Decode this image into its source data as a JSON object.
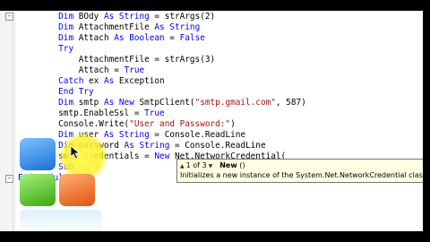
{
  "code": {
    "lines": [
      {
        "indent": "        ",
        "segs": [
          [
            "kw",
            "Dim "
          ],
          [
            "",
            "BOdy "
          ],
          [
            "kw",
            "As "
          ],
          [
            "kw",
            "String"
          ],
          [
            "",
            " = strArgs(2)"
          ]
        ]
      },
      {
        "indent": "        ",
        "segs": [
          [
            "kw",
            "Dim "
          ],
          [
            "",
            "AttachmentFile "
          ],
          [
            "kw",
            "As "
          ],
          [
            "kw",
            "String"
          ]
        ]
      },
      {
        "indent": "        ",
        "segs": [
          [
            "kw",
            "Dim "
          ],
          [
            "",
            "Attach "
          ],
          [
            "kw",
            "As "
          ],
          [
            "kw",
            "Boolean"
          ],
          [
            "",
            " = "
          ],
          [
            "kw",
            "False"
          ]
        ]
      },
      {
        "indent": "        ",
        "segs": [
          [
            "kw",
            "Try"
          ]
        ]
      },
      {
        "indent": "            ",
        "segs": [
          [
            "",
            "AttachmentFile = strArgs(3)"
          ]
        ]
      },
      {
        "indent": "            ",
        "segs": [
          [
            "",
            "Attach = "
          ],
          [
            "kw",
            "True"
          ]
        ]
      },
      {
        "indent": "        ",
        "segs": [
          [
            "kw",
            "Catch "
          ],
          [
            "",
            "ex "
          ],
          [
            "kw",
            "As "
          ],
          [
            "",
            "Exception"
          ]
        ]
      },
      {
        "indent": "        ",
        "segs": [
          [
            "kw",
            "End Try"
          ]
        ]
      },
      {
        "indent": "        ",
        "segs": [
          [
            "kw",
            "Dim "
          ],
          [
            "",
            "smtp "
          ],
          [
            "kw",
            "As New "
          ],
          [
            "",
            "SmtpClient("
          ],
          [
            "str",
            "\"smtp.gmail.com\""
          ],
          [
            "",
            ", 587)"
          ]
        ]
      },
      {
        "indent": "        ",
        "segs": [
          [
            "",
            "smtp.EnableSsl = "
          ],
          [
            "kw",
            "True"
          ]
        ]
      },
      {
        "indent": "        ",
        "segs": [
          [
            "",
            "Console.Write("
          ],
          [
            "str",
            "\"User and Password:\""
          ],
          [
            "",
            ")"
          ]
        ]
      },
      {
        "indent": "        ",
        "segs": [
          [
            "kw",
            "Dim "
          ],
          [
            "",
            "user "
          ],
          [
            "kw",
            "As "
          ],
          [
            "kw",
            "String"
          ],
          [
            "",
            " = Console.ReadLine"
          ]
        ]
      },
      {
        "indent": "        ",
        "segs": [
          [
            "kw",
            "Dim "
          ],
          [
            "",
            "password "
          ],
          [
            "kw",
            "As "
          ],
          [
            "kw",
            "String"
          ],
          [
            "",
            " = Console.ReadLine"
          ]
        ]
      },
      {
        "indent": "        ",
        "segs": [
          [
            "",
            "smtp.Credentials = "
          ],
          [
            "kw",
            "New "
          ],
          [
            "",
            "Net.NetworkCredential("
          ]
        ]
      },
      {
        "indent": "    ",
        "segs": [
          [
            "kw",
            "End Sub"
          ]
        ]
      },
      {
        "indent": "",
        "segs": [
          [
            "kw",
            "End Module"
          ]
        ]
      }
    ]
  },
  "tooltip": {
    "counter": "1 of 3",
    "method_name": "New",
    "signature_rest": " ()",
    "description": "Initializes a new instance of the System.Net.NetworkCredential class."
  },
  "colors": {
    "keyword": "#0000ff",
    "string": "#a31515",
    "tooltip_bg": "#ffffe1"
  }
}
